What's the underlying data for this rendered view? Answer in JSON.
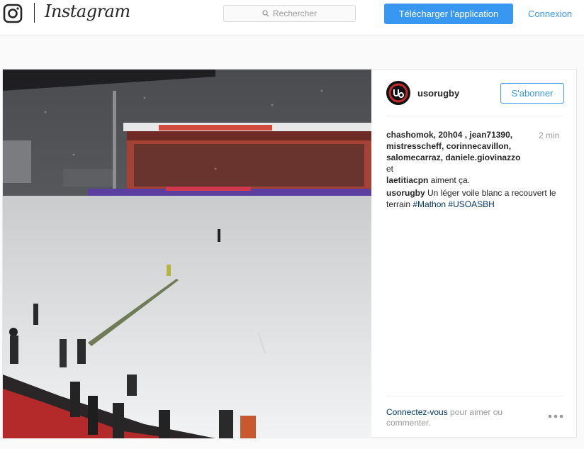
{
  "header": {
    "brand": "Instagram",
    "search_placeholder": "Rechercher",
    "download_label": "Télécharger l'application",
    "login_label": "Connexion"
  },
  "post": {
    "username": "usorugby",
    "follow_label": "S'abonner",
    "time_ago": "2 min",
    "likes": {
      "users_line1": "chashomok, 20h04  , jean71390,",
      "users_line2": "mistresscheff, corinnecavillon,",
      "users_line3a": "salomecarraz, daniele.giovinazzo",
      "users_and": " et",
      "users_line4": "laetitiacpn",
      "suffix": " aiment ça."
    },
    "caption": {
      "author": "usorugby",
      "text": " Un léger voile blanc a recouvert le terrain ",
      "tags": [
        "#Mathon",
        "#USOASBH"
      ]
    },
    "comment_prompt": {
      "link": "Connectez-vous",
      "text": " pour aimer ou commenter."
    },
    "photo_icons": [
      "instagram-logo-icon",
      "search-icon",
      "more-options-icon"
    ]
  }
}
